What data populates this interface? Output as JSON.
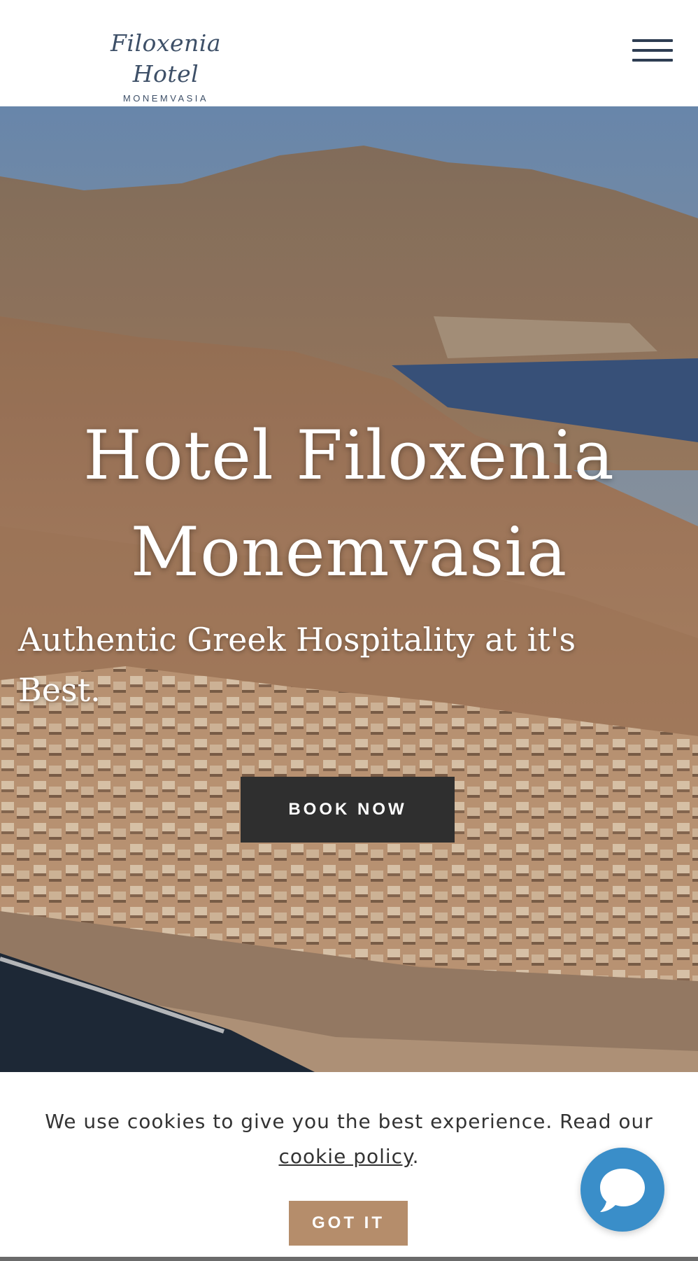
{
  "header": {
    "logo_script": "Filoxenia Hotel",
    "logo_sub": "MONEMVASIA",
    "menu_icon": "hamburger-menu-icon"
  },
  "hero": {
    "title_line1": "Hotel Filoxenia",
    "title_line2": "Monemvasia",
    "subtitle": "Authentic Greek Hospitality at it's Best.",
    "book_label": "BOOK NOW"
  },
  "cookie": {
    "text_before": "We use cookies to give you the best experience. Read our ",
    "link_label": "cookie policy",
    "text_after": ".",
    "button_label": "GOT IT"
  },
  "chat": {
    "icon": "chat-bubble-icon"
  },
  "colors": {
    "logo": "#3e5068",
    "book_button": "#2f2f2f",
    "got_it_button": "#b58d6b",
    "chat_button": "#3a8ec9"
  }
}
